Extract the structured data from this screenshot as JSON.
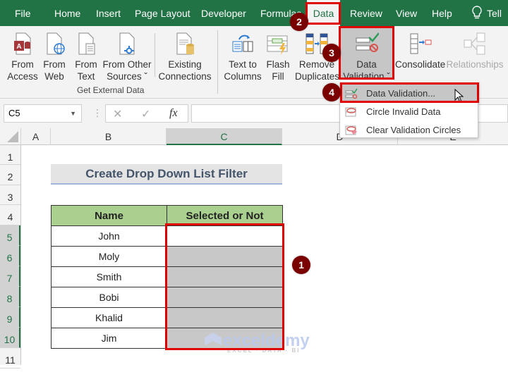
{
  "menu": {
    "tabs": [
      "File",
      "Home",
      "Insert",
      "Page Layout",
      "Developer",
      "Formulas",
      "Data",
      "Review",
      "View",
      "Help"
    ],
    "active_tab": "Data",
    "tell_me": "Tell"
  },
  "ribbon": {
    "get_external_data": {
      "label": "Get External Data",
      "buttons": [
        {
          "line1": "From",
          "line2": "Access",
          "icon": "access-database-icon"
        },
        {
          "line1": "From",
          "line2": "Web",
          "icon": "web-globe-icon"
        },
        {
          "line1": "From",
          "line2": "Text",
          "icon": "text-file-icon"
        },
        {
          "line1": "From Other",
          "line2": "Sources ˇ",
          "icon": "other-sources-icon"
        }
      ]
    },
    "existing_connections": {
      "line1": "Existing",
      "line2": "Connections"
    },
    "data_tools": [
      {
        "line1": "Text to",
        "line2": "Columns"
      },
      {
        "line1": "Flash",
        "line2": "Fill"
      },
      {
        "line1": "Remove",
        "line2": "Duplicates"
      },
      {
        "line1": "Data",
        "line2": "Validation ˇ"
      },
      {
        "line1": "Consolidate",
        "line2": ""
      },
      {
        "line1": "Relationships",
        "line2": ""
      }
    ]
  },
  "dropdown": {
    "items": [
      {
        "label": "Data Validation...",
        "highlighted": true
      },
      {
        "label": "Circle Invalid Data",
        "highlighted": false
      },
      {
        "label": "Clear Validation Circles",
        "highlighted": false
      }
    ]
  },
  "formula_bar": {
    "name_box": "C5",
    "cancel": "✕",
    "enter": "✓",
    "fx": "fx",
    "value": ""
  },
  "sheet": {
    "columns": [
      "A",
      "B",
      "C",
      "D",
      "E"
    ],
    "rows": [
      "1",
      "2",
      "3",
      "4",
      "5",
      "6",
      "7",
      "8",
      "9",
      "10",
      "11"
    ],
    "title": "Create Drop Down List Filter",
    "table": {
      "headers": [
        "Name",
        "Selected or Not"
      ],
      "rows": [
        [
          "John",
          ""
        ],
        [
          "Moly",
          ""
        ],
        [
          "Smith",
          ""
        ],
        [
          "Bobi",
          ""
        ],
        [
          "Khalid",
          ""
        ],
        [
          "Jim",
          ""
        ]
      ]
    }
  },
  "annotations": {
    "badges": [
      "1",
      "2",
      "3",
      "4"
    ]
  },
  "watermark": {
    "brand": "exceldemy",
    "tagline": "EXCEL · DATA · BI"
  }
}
